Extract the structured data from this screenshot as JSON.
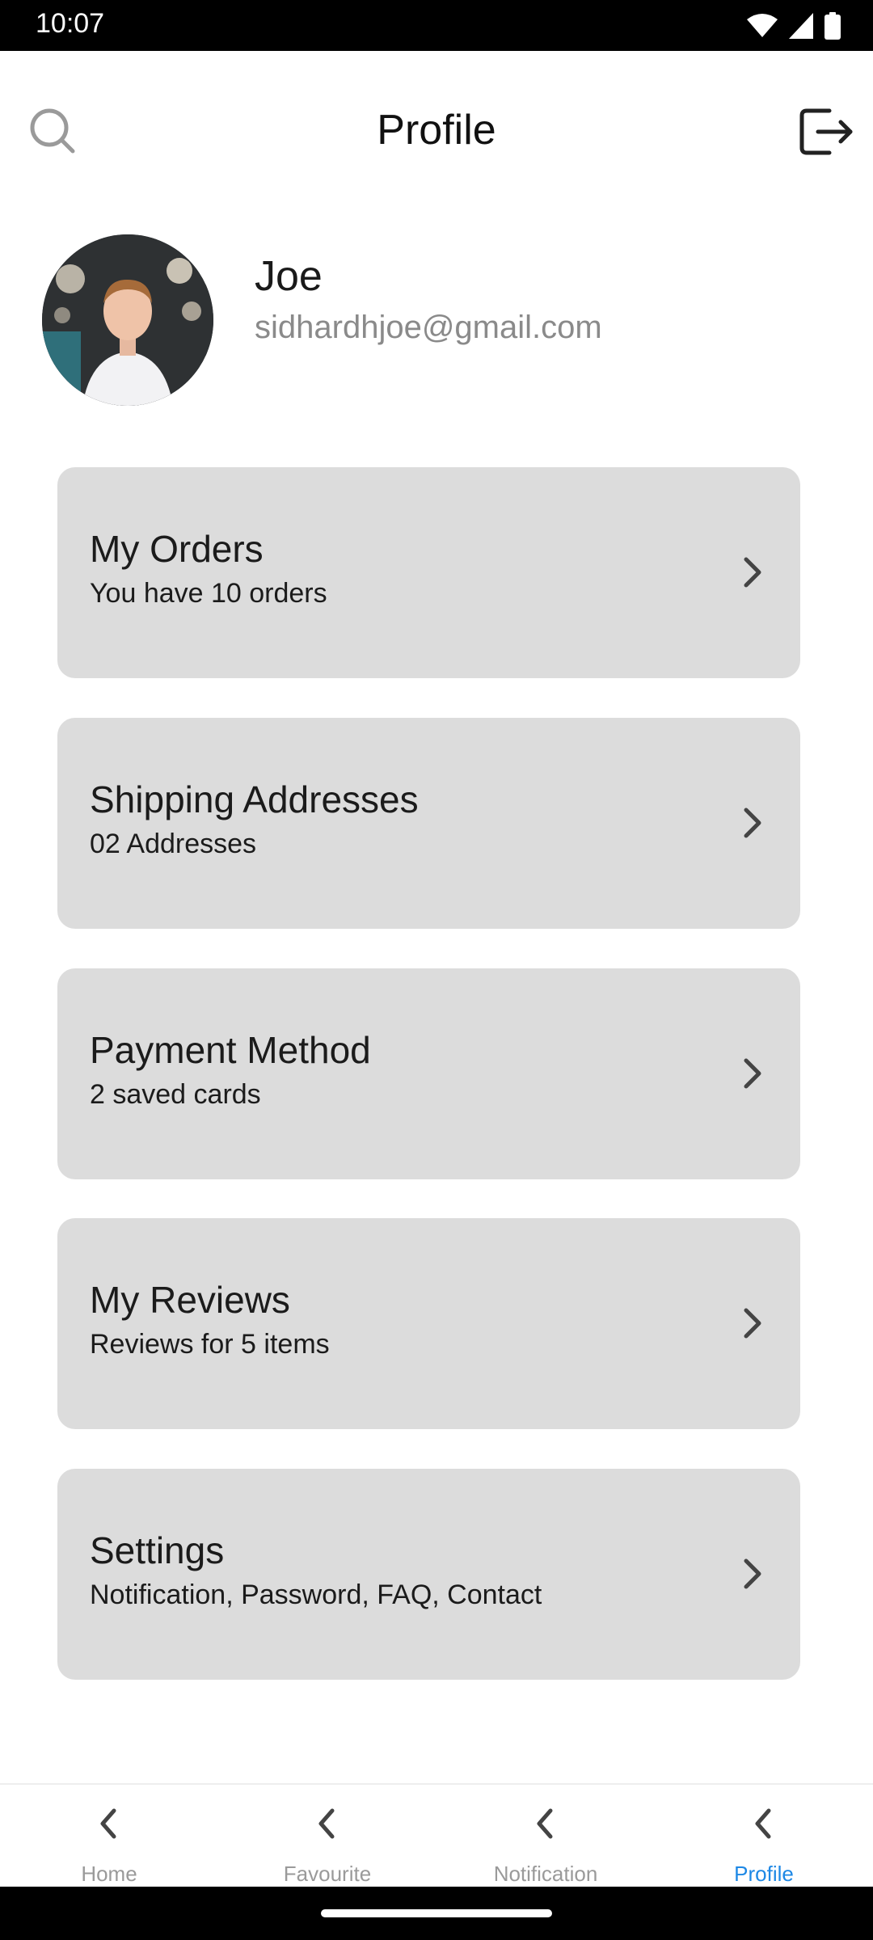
{
  "status_bar": {
    "time": "10:07",
    "icons": [
      "wifi-icon",
      "cellular-signal-icon",
      "battery-icon"
    ]
  },
  "header": {
    "title": "Profile",
    "left_icon": "search-icon",
    "right_icon": "logout-icon"
  },
  "profile": {
    "name": "Joe",
    "email": "sidhardhjoe@gmail.com"
  },
  "menu": [
    {
      "title": "My Orders",
      "subtitle": "You have 10 orders"
    },
    {
      "title": "Shipping Addresses",
      "subtitle": "02 Addresses"
    },
    {
      "title": "Payment Method",
      "subtitle": "2 saved cards"
    },
    {
      "title": "My Reviews",
      "subtitle": "Reviews for 5 items"
    },
    {
      "title": "Settings",
      "subtitle": "Notification, Password, FAQ, Contact"
    }
  ],
  "bottom_nav": [
    {
      "label": "Home",
      "icon": "chevron-left-icon"
    },
    {
      "label": "Favourite",
      "icon": "chevron-left-icon"
    },
    {
      "label": "Notification",
      "icon": "chevron-left-icon"
    },
    {
      "label": "Profile",
      "icon": "chevron-left-icon",
      "active": true
    }
  ],
  "colors": {
    "card_background": "#dcdcdc",
    "active_nav": "#1e88e5",
    "inactive_nav": "#9a9a9a",
    "email_text": "#8a8a8a"
  }
}
